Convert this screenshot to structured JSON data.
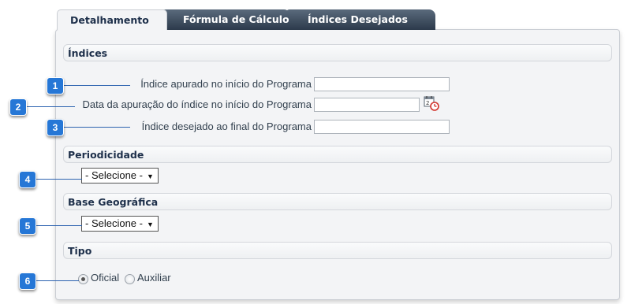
{
  "tabs": [
    "Detalhamento",
    "Fórmula de Cálculo",
    "Índices Desejados"
  ],
  "sections": {
    "indices": "Índices",
    "periodicidade": "Periodicidade",
    "base": "Base Geográfica",
    "tipo": "Tipo"
  },
  "fields": {
    "indice_inicio": "Índice apurado no início do Programa",
    "data_apuracao": "Data da apuração do índice no início do Programa",
    "indice_final": "Índice desejado ao final do Programa"
  },
  "selects": {
    "periodicidade": "- Selecione -",
    "base": "- Selecione -"
  },
  "radios": {
    "oficial": "Oficial",
    "auxiliar": "Auxiliar",
    "selected": "Oficial"
  },
  "callouts": [
    "1",
    "2",
    "3",
    "4",
    "5",
    "6"
  ],
  "colors": {
    "callout": "#2677d6",
    "tab_inactive": "#3d4b5c",
    "title": "#1d2f4a"
  }
}
